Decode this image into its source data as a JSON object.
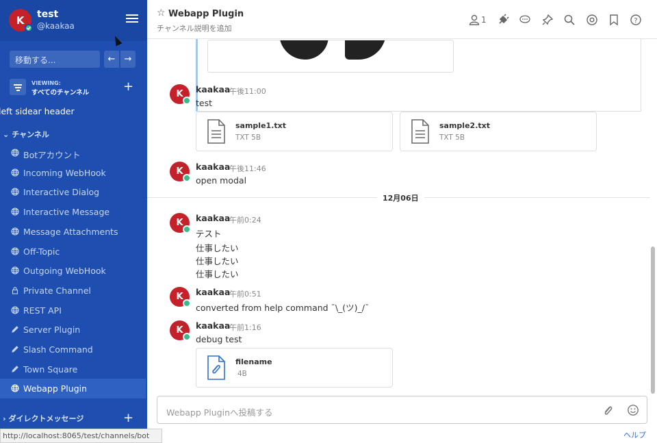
{
  "team": {
    "name": "test",
    "username": "@kaakaa",
    "initial": "K"
  },
  "jump": {
    "placeholder": "移動する..."
  },
  "viewing": {
    "label": "VIEWING:",
    "value": "すべてのチャンネル"
  },
  "left_header": "left sidear header",
  "channels_title": "チャンネル",
  "channels": [
    {
      "label": "Botアカウント",
      "icon": "globe-icon",
      "active": false
    },
    {
      "label": "Incoming WebHook",
      "icon": "globe-icon",
      "active": false
    },
    {
      "label": "Interactive Dialog",
      "icon": "globe-icon",
      "active": false
    },
    {
      "label": "Interactive Message",
      "icon": "globe-icon",
      "active": false
    },
    {
      "label": "Message Attachments",
      "icon": "globe-icon",
      "active": false
    },
    {
      "label": "Off-Topic",
      "icon": "globe-icon",
      "active": false
    },
    {
      "label": "Outgoing WebHook",
      "icon": "globe-icon",
      "active": false
    },
    {
      "label": "Private Channel",
      "icon": "lock-icon",
      "active": false
    },
    {
      "label": "REST API",
      "icon": "globe-icon",
      "active": false
    },
    {
      "label": "Server Plugin",
      "icon": "pencil-icon",
      "active": false
    },
    {
      "label": "Slash Command",
      "icon": "pencil-icon",
      "active": false
    },
    {
      "label": "Town Square",
      "icon": "pencil-icon",
      "active": false
    },
    {
      "label": "Webapp Plugin",
      "icon": "globe-icon",
      "active": true
    }
  ],
  "dm_title": "ダイレクトメッセージ",
  "status_url": "http://localhost:8065/test/channels/bot",
  "header": {
    "channel_name": "Webapp Plugin",
    "description": "チャンネル説明を追加",
    "member_count": "1"
  },
  "date_separator": "12月06日",
  "posts": [
    {
      "user": "kaakaa",
      "time": "午後11:00",
      "lines": [
        "test"
      ]
    },
    {
      "user": "kaakaa",
      "time": "午後11:46",
      "lines": [
        "open modal"
      ]
    },
    {
      "user": "kaakaa",
      "time": "午前0:24",
      "lines": [
        "テスト",
        "仕事したい",
        "仕事したい",
        "仕事したい"
      ]
    },
    {
      "user": "kaakaa",
      "time": "午前0:51",
      "lines": [
        "converted from help command ¯\\_(ツ)_/¯"
      ]
    },
    {
      "user": "kaakaa",
      "time": "午前1:16",
      "lines": [
        "debug test"
      ]
    }
  ],
  "files": [
    {
      "name": "sample1.txt",
      "meta": "TXT 5B"
    },
    {
      "name": "sample2.txt",
      "meta": "TXT 5B"
    },
    {
      "name": "filename",
      "meta": "4B"
    }
  ],
  "input": {
    "placeholder": "Webapp Pluginへ投稿する"
  },
  "help": "ヘルプ",
  "colors": {
    "sidebar": "#1e4fb0",
    "active_channel": "#2f61c2",
    "avatar": "#c4212a",
    "online": "#3db887"
  }
}
